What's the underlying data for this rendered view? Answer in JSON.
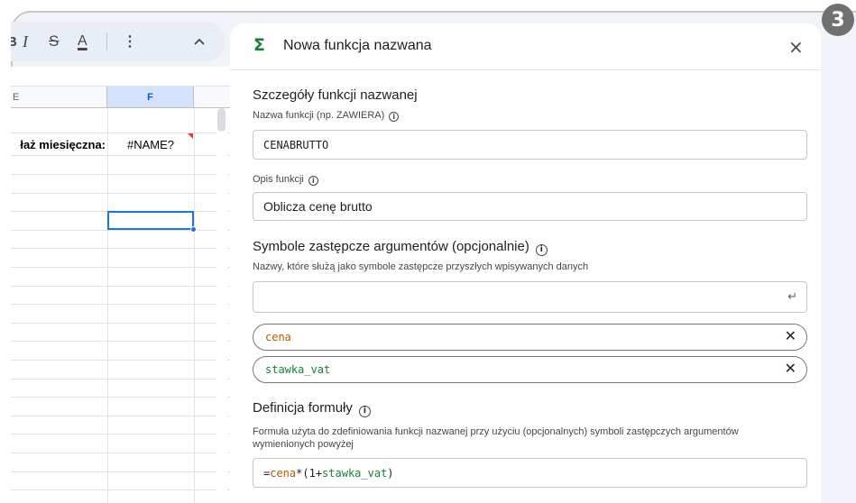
{
  "badge": "3",
  "toolbar": {
    "bold": "B",
    "italic": "I",
    "strike": "S",
    "text_color": "A",
    "more": "⋮",
    "collapse": "^"
  },
  "sheet": {
    "columns": [
      "E",
      "F"
    ],
    "label_cell": "łaż miesięczna:",
    "error_cell": "#NAME?"
  },
  "panel": {
    "icon": "Σ",
    "title": "Nowa funkcja nazwana",
    "close": "×",
    "details_title": "Szczegóły funkcji nazwanej",
    "name_label": "Nazwa funkcji (np. ZAWIERA)",
    "name_value": "CENABRUTTO",
    "desc_label": "Opis funkcji",
    "desc_value": "Oblicza cenę brutto",
    "args_title": "Symbole zastępcze argumentów (opcjonalnie)",
    "args_help": "Nazwy, które służą jako symbole zastępcze przyszłych wpisywanych danych",
    "args_input_value": "",
    "args": [
      {
        "name": "cena",
        "color": "#b05e00"
      },
      {
        "name": "stawka_vat",
        "color": "#188038"
      }
    ],
    "formula_title": "Definicja formuły",
    "formula_help": "Formuła użyta do zdefiniowania funkcji nazwanej przy użyciu (opcjonalnych) symboli zastępczych argumentów wymienionych powyżej",
    "formula": {
      "eq": "=",
      "arg1": "cena",
      "op": "*(1+",
      "arg2": "stawka_vat",
      "close": ")"
    }
  },
  "colors": {
    "accent": "#1a73e8",
    "sigma": "#188038",
    "arg_orange": "#b05e00",
    "arg_green": "#188038",
    "error_flag": "#e53935"
  }
}
